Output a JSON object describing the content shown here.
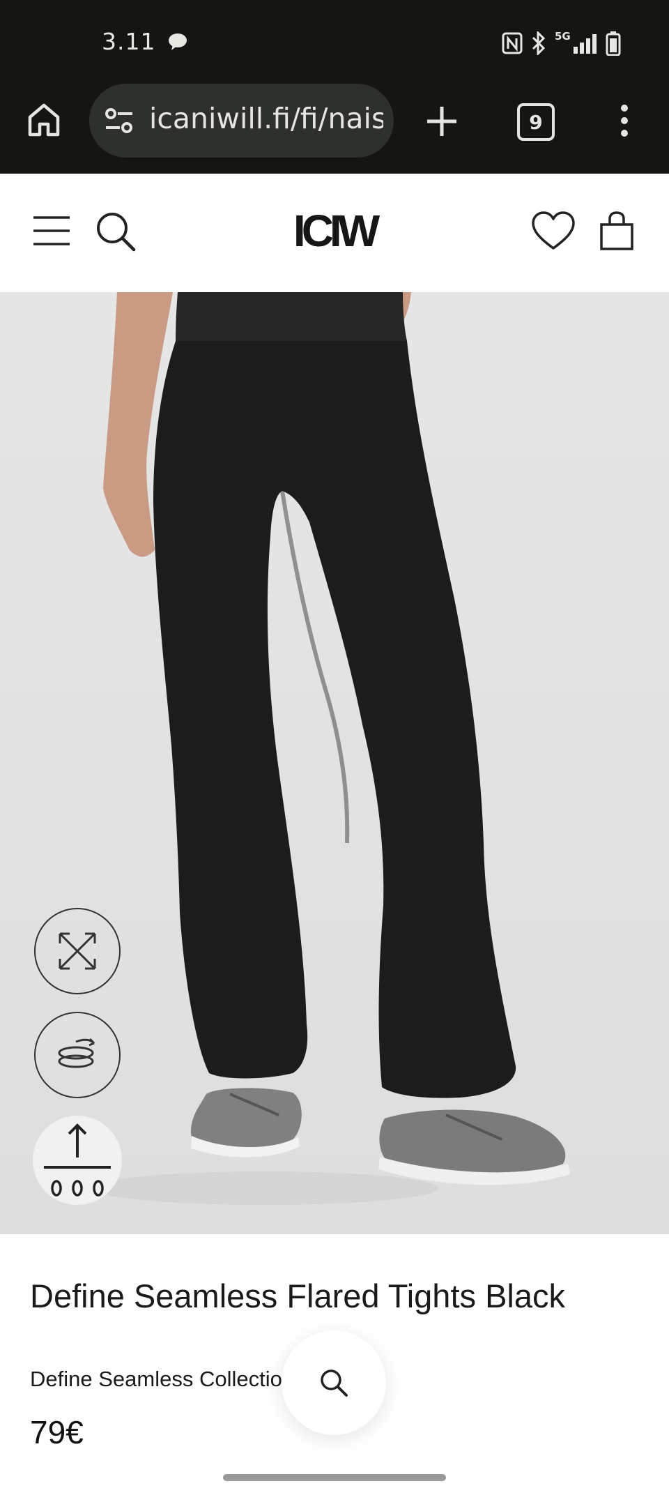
{
  "status_bar": {
    "time": "3.11",
    "network": "5G"
  },
  "browser": {
    "url": "icaniwill.fi/fi/naise",
    "tab_count": "9"
  },
  "site": {
    "logo": "ICIW"
  },
  "product": {
    "title": "Define Seamless Flared Tights Black",
    "collection": "Define Seamless Collection",
    "price": "79€"
  },
  "icons": {
    "home": "home-icon",
    "site_settings": "tune-icon",
    "new_tab": "plus-icon",
    "menu_more": "more-vert-icon",
    "hamburger": "menu-icon",
    "search": "search-icon",
    "wishlist": "heart-icon",
    "cart": "bag-icon",
    "expand": "expand-icon",
    "rotate": "rotate-360-icon",
    "size": "size-guide-icon"
  },
  "colors": {
    "chrome_bg": "#151612",
    "url_pill_bg": "#2e302b",
    "image_bg": "#e3e3e3",
    "text": "#1a1a1a"
  }
}
